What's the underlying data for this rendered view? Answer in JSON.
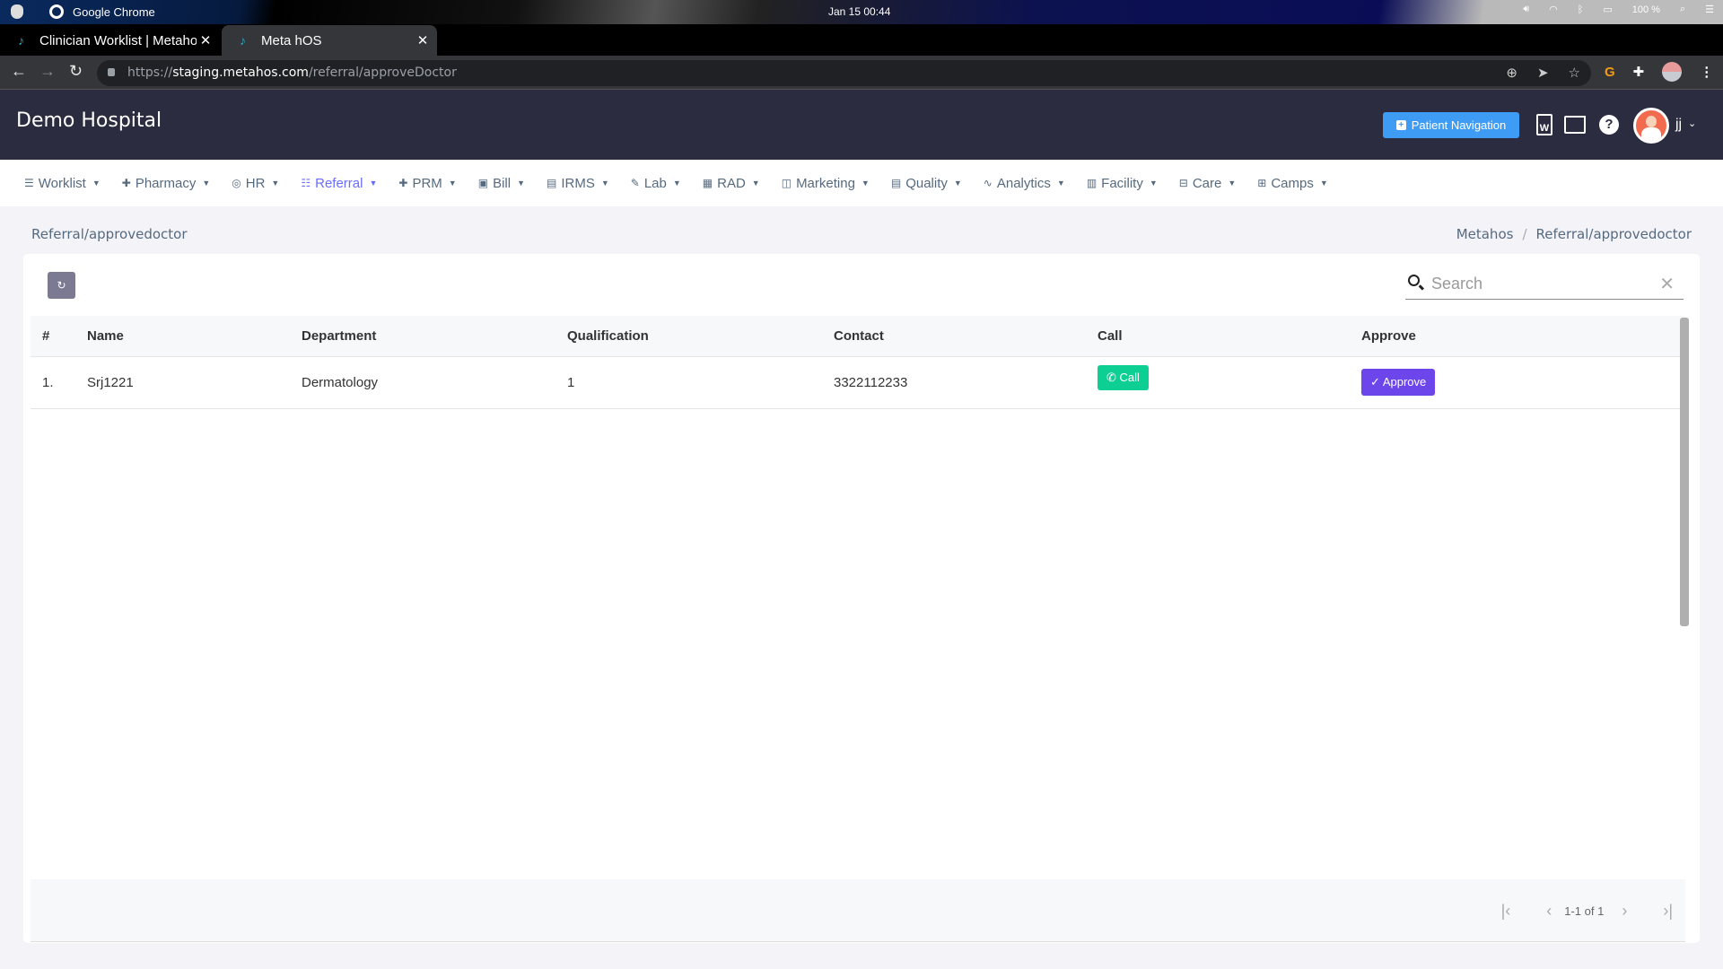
{
  "os": {
    "app_name": "Google Chrome",
    "clock": "Jan 15  00:44",
    "battery": "100 %"
  },
  "browser": {
    "tabs": [
      {
        "label": "Clinician Worklist | Metahos",
        "active": false
      },
      {
        "label": "Meta hOS",
        "active": true
      }
    ],
    "url_scheme": "https://",
    "url_host": "staging.metahos.com",
    "url_path": "/referral/approveDoctor"
  },
  "header": {
    "hospital_name": "Demo Hospital",
    "patient_nav_label": "Patient Navigation",
    "word_icon_letter": "W",
    "help_icon": "?",
    "user_name": "jj"
  },
  "nav": {
    "items": [
      {
        "label": "Worklist",
        "icon": "☰",
        "active": false
      },
      {
        "label": "Pharmacy",
        "icon": "✚",
        "active": false
      },
      {
        "label": "HR",
        "icon": "◎",
        "active": false
      },
      {
        "label": "Referral",
        "icon": "☷",
        "active": true
      },
      {
        "label": "PRM",
        "icon": "✚",
        "active": false
      },
      {
        "label": "Bill",
        "icon": "▣",
        "active": false
      },
      {
        "label": "IRMS",
        "icon": "▤",
        "active": false
      },
      {
        "label": "Lab",
        "icon": "✎",
        "active": false
      },
      {
        "label": "RAD",
        "icon": "▦",
        "active": false
      },
      {
        "label": "Marketing",
        "icon": "◫",
        "active": false
      },
      {
        "label": "Quality",
        "icon": "▤",
        "active": false
      },
      {
        "label": "Analytics",
        "icon": "∿",
        "active": false
      },
      {
        "label": "Facility",
        "icon": "▥",
        "active": false
      },
      {
        "label": "Care",
        "icon": "⊟",
        "active": false
      },
      {
        "label": "Camps",
        "icon": "⊞",
        "active": false
      }
    ],
    "caret": "▼"
  },
  "page": {
    "title": "Referral/approvedoctor",
    "breadcrumb": [
      "Metahos",
      "Referral/approvedoctor"
    ],
    "breadcrumb_sep": "/"
  },
  "toolbar": {
    "refresh_icon": "↻",
    "search_placeholder": "Search",
    "search_value": "",
    "clear_icon": "✕"
  },
  "table": {
    "columns": [
      "#",
      "Name",
      "Department",
      "Qualification",
      "Contact",
      "Call",
      "Approve"
    ],
    "rows": [
      {
        "index": "1.",
        "name": "Srj1221",
        "department": "Dermatology",
        "qualification": "1",
        "contact": "3322112233",
        "call_label": "Call",
        "approve_label": "Approve"
      }
    ]
  },
  "pagination": {
    "info": "1-1 of 1",
    "first": "|‹",
    "prev": "‹",
    "next": "›",
    "last": "›|"
  },
  "colors": {
    "header_bg": "#2b2c40",
    "accent": "#696cff",
    "patient_nav": "#3f9cf5",
    "call_button": "#0ecf93",
    "approve_button": "#6c46ea"
  }
}
